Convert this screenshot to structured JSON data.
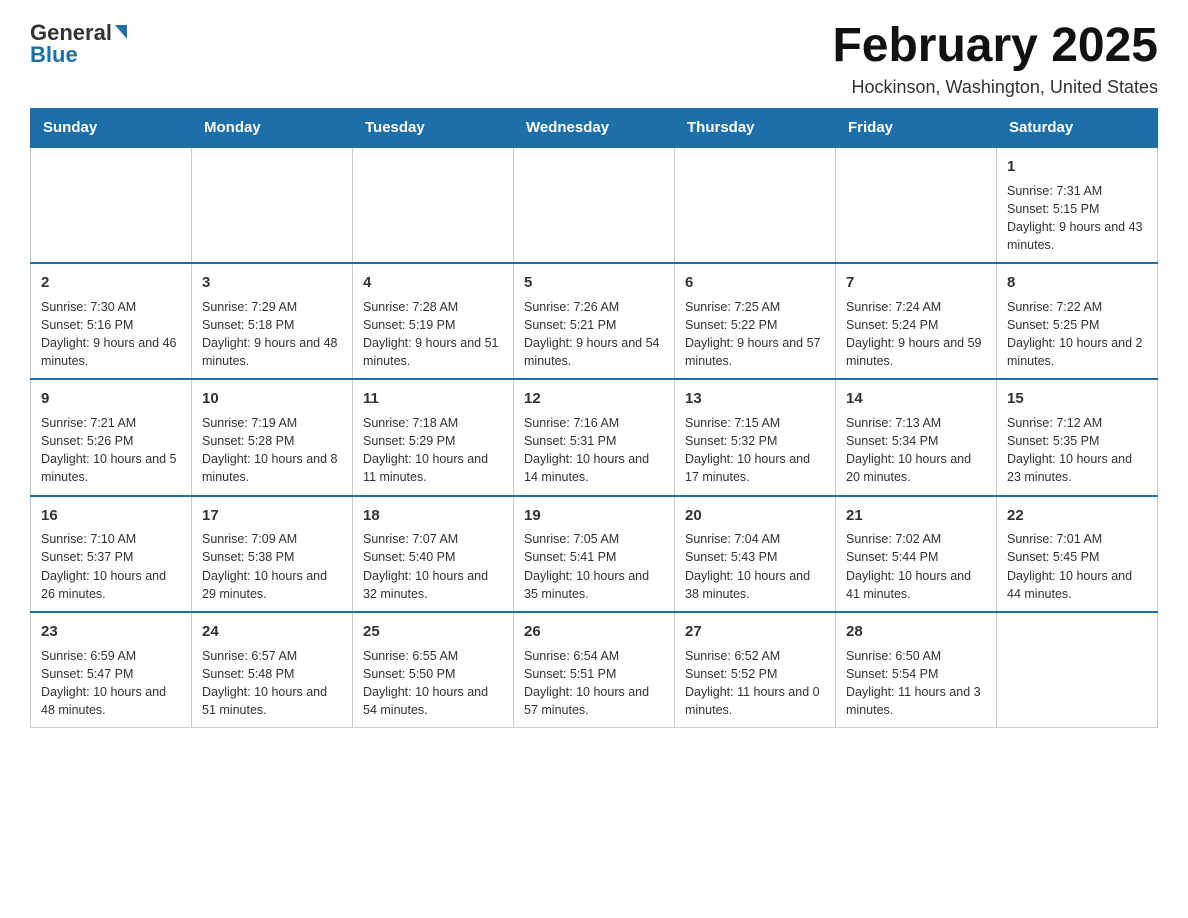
{
  "header": {
    "logo_general": "General",
    "logo_blue": "Blue",
    "month_title": "February 2025",
    "location": "Hockinson, Washington, United States"
  },
  "days_of_week": [
    "Sunday",
    "Monday",
    "Tuesday",
    "Wednesday",
    "Thursday",
    "Friday",
    "Saturday"
  ],
  "weeks": [
    {
      "days": [
        {
          "number": "",
          "info": ""
        },
        {
          "number": "",
          "info": ""
        },
        {
          "number": "",
          "info": ""
        },
        {
          "number": "",
          "info": ""
        },
        {
          "number": "",
          "info": ""
        },
        {
          "number": "",
          "info": ""
        },
        {
          "number": "1",
          "info": "Sunrise: 7:31 AM\nSunset: 5:15 PM\nDaylight: 9 hours and 43 minutes."
        }
      ]
    },
    {
      "days": [
        {
          "number": "2",
          "info": "Sunrise: 7:30 AM\nSunset: 5:16 PM\nDaylight: 9 hours and 46 minutes."
        },
        {
          "number": "3",
          "info": "Sunrise: 7:29 AM\nSunset: 5:18 PM\nDaylight: 9 hours and 48 minutes."
        },
        {
          "number": "4",
          "info": "Sunrise: 7:28 AM\nSunset: 5:19 PM\nDaylight: 9 hours and 51 minutes."
        },
        {
          "number": "5",
          "info": "Sunrise: 7:26 AM\nSunset: 5:21 PM\nDaylight: 9 hours and 54 minutes."
        },
        {
          "number": "6",
          "info": "Sunrise: 7:25 AM\nSunset: 5:22 PM\nDaylight: 9 hours and 57 minutes."
        },
        {
          "number": "7",
          "info": "Sunrise: 7:24 AM\nSunset: 5:24 PM\nDaylight: 9 hours and 59 minutes."
        },
        {
          "number": "8",
          "info": "Sunrise: 7:22 AM\nSunset: 5:25 PM\nDaylight: 10 hours and 2 minutes."
        }
      ]
    },
    {
      "days": [
        {
          "number": "9",
          "info": "Sunrise: 7:21 AM\nSunset: 5:26 PM\nDaylight: 10 hours and 5 minutes."
        },
        {
          "number": "10",
          "info": "Sunrise: 7:19 AM\nSunset: 5:28 PM\nDaylight: 10 hours and 8 minutes."
        },
        {
          "number": "11",
          "info": "Sunrise: 7:18 AM\nSunset: 5:29 PM\nDaylight: 10 hours and 11 minutes."
        },
        {
          "number": "12",
          "info": "Sunrise: 7:16 AM\nSunset: 5:31 PM\nDaylight: 10 hours and 14 minutes."
        },
        {
          "number": "13",
          "info": "Sunrise: 7:15 AM\nSunset: 5:32 PM\nDaylight: 10 hours and 17 minutes."
        },
        {
          "number": "14",
          "info": "Sunrise: 7:13 AM\nSunset: 5:34 PM\nDaylight: 10 hours and 20 minutes."
        },
        {
          "number": "15",
          "info": "Sunrise: 7:12 AM\nSunset: 5:35 PM\nDaylight: 10 hours and 23 minutes."
        }
      ]
    },
    {
      "days": [
        {
          "number": "16",
          "info": "Sunrise: 7:10 AM\nSunset: 5:37 PM\nDaylight: 10 hours and 26 minutes."
        },
        {
          "number": "17",
          "info": "Sunrise: 7:09 AM\nSunset: 5:38 PM\nDaylight: 10 hours and 29 minutes."
        },
        {
          "number": "18",
          "info": "Sunrise: 7:07 AM\nSunset: 5:40 PM\nDaylight: 10 hours and 32 minutes."
        },
        {
          "number": "19",
          "info": "Sunrise: 7:05 AM\nSunset: 5:41 PM\nDaylight: 10 hours and 35 minutes."
        },
        {
          "number": "20",
          "info": "Sunrise: 7:04 AM\nSunset: 5:43 PM\nDaylight: 10 hours and 38 minutes."
        },
        {
          "number": "21",
          "info": "Sunrise: 7:02 AM\nSunset: 5:44 PM\nDaylight: 10 hours and 41 minutes."
        },
        {
          "number": "22",
          "info": "Sunrise: 7:01 AM\nSunset: 5:45 PM\nDaylight: 10 hours and 44 minutes."
        }
      ]
    },
    {
      "days": [
        {
          "number": "23",
          "info": "Sunrise: 6:59 AM\nSunset: 5:47 PM\nDaylight: 10 hours and 48 minutes."
        },
        {
          "number": "24",
          "info": "Sunrise: 6:57 AM\nSunset: 5:48 PM\nDaylight: 10 hours and 51 minutes."
        },
        {
          "number": "25",
          "info": "Sunrise: 6:55 AM\nSunset: 5:50 PM\nDaylight: 10 hours and 54 minutes."
        },
        {
          "number": "26",
          "info": "Sunrise: 6:54 AM\nSunset: 5:51 PM\nDaylight: 10 hours and 57 minutes."
        },
        {
          "number": "27",
          "info": "Sunrise: 6:52 AM\nSunset: 5:52 PM\nDaylight: 11 hours and 0 minutes."
        },
        {
          "number": "28",
          "info": "Sunrise: 6:50 AM\nSunset: 5:54 PM\nDaylight: 11 hours and 3 minutes."
        },
        {
          "number": "",
          "info": ""
        }
      ]
    }
  ]
}
